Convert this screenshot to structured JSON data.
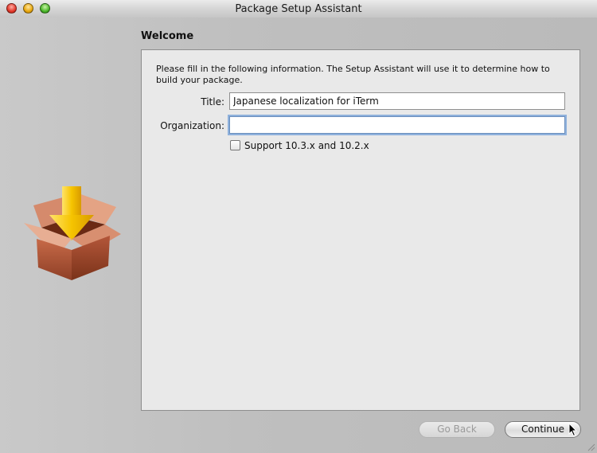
{
  "window": {
    "title": "Package Setup Assistant"
  },
  "page": {
    "heading": "Welcome",
    "intro": "Please fill in the following information. The Setup Assistant will use it to determine how to build your package."
  },
  "form": {
    "title_label": "Title:",
    "title_value": "Japanese localization for iTerm",
    "organization_label": "Organization:",
    "organization_value": "",
    "support_label": "Support 10.3.x and 10.2.x",
    "support_checked": false
  },
  "buttons": {
    "back_label": "Go Back",
    "back_enabled": false,
    "continue_label": "Continue"
  },
  "icons": {
    "window_controls": [
      "close-icon",
      "minimize-icon",
      "zoom-icon"
    ],
    "package": "package-box-download-icon",
    "cursor": "mouse-pointer-icon"
  },
  "colors": {
    "focus_ring": "#8fb1dc",
    "panel_background": "#e9e9e9",
    "arrow": "#f2c200",
    "box": "#b8583a"
  }
}
